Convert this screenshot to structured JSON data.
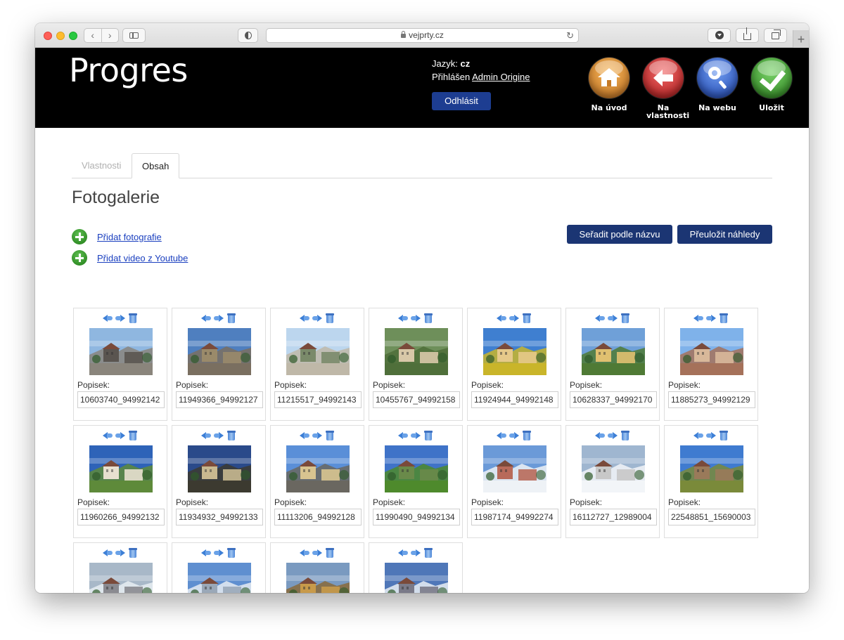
{
  "browser": {
    "url": "vejprty.cz",
    "back_icon": "‹",
    "forward_icon": "›",
    "reload_icon": "↻",
    "newtab_icon": "+"
  },
  "header": {
    "logo": "Progres",
    "language_label": "Jazyk:",
    "language_value": "cz",
    "logged_label": "Přihlášen",
    "user_name": "Admin Origine",
    "logout_label": "Odhlásit",
    "buttons": [
      {
        "label": "Na úvod",
        "icon": "home-icon",
        "color": "#d8892c"
      },
      {
        "label": "Na vlastnosti",
        "icon": "back-arrow-icon",
        "color": "#d12a2a"
      },
      {
        "label": "Na webu",
        "icon": "magnifier-icon",
        "color": "#2f5fd0"
      },
      {
        "label": "Uložit",
        "icon": "checkmark-icon",
        "color": "#3aa12a"
      }
    ]
  },
  "tabs": {
    "properties": "Vlastnosti",
    "content": "Obsah",
    "active": "Obsah"
  },
  "page": {
    "title": "Fotogalerie",
    "add_photos": "Přidat fotografie",
    "add_video": "Přidat video z Youtube",
    "sort_button": "Seřadit podle názvu",
    "regenerate_button": "Přeuložit náhledy"
  },
  "gallery": {
    "caption_label": "Popisek:",
    "photos": [
      {
        "caption": "10603740_94992142",
        "scene": "fountain"
      },
      {
        "caption": "11949366_94992127",
        "scene": "square"
      },
      {
        "caption": "11215517_94992143",
        "scene": "park"
      },
      {
        "caption": "10455767_94992158",
        "scene": "town-aerial"
      },
      {
        "caption": "11924944_94992148",
        "scene": "yellow-building"
      },
      {
        "caption": "10628337_94992170",
        "scene": "hills"
      },
      {
        "caption": "11885273_94992129",
        "scene": "plaza-fountain"
      },
      {
        "caption": "11960266_94992132",
        "scene": "church"
      },
      {
        "caption": "11934932_94992133",
        "scene": "town-hall"
      },
      {
        "caption": "11113206_94992128",
        "scene": "school"
      },
      {
        "caption": "11990490_94992134",
        "scene": "meadow"
      },
      {
        "caption": "11987174_94992274",
        "scene": "winter-square"
      },
      {
        "caption": "16112727_12989004",
        "scene": "snowy-path"
      },
      {
        "caption": "22548851_15690003",
        "scene": "autumn-church"
      },
      {
        "caption": "",
        "scene": "winter-town"
      },
      {
        "caption": "",
        "scene": "winter-valley"
      },
      {
        "caption": "",
        "scene": "autumn-hills"
      },
      {
        "caption": "",
        "scene": "winter-church"
      }
    ]
  }
}
